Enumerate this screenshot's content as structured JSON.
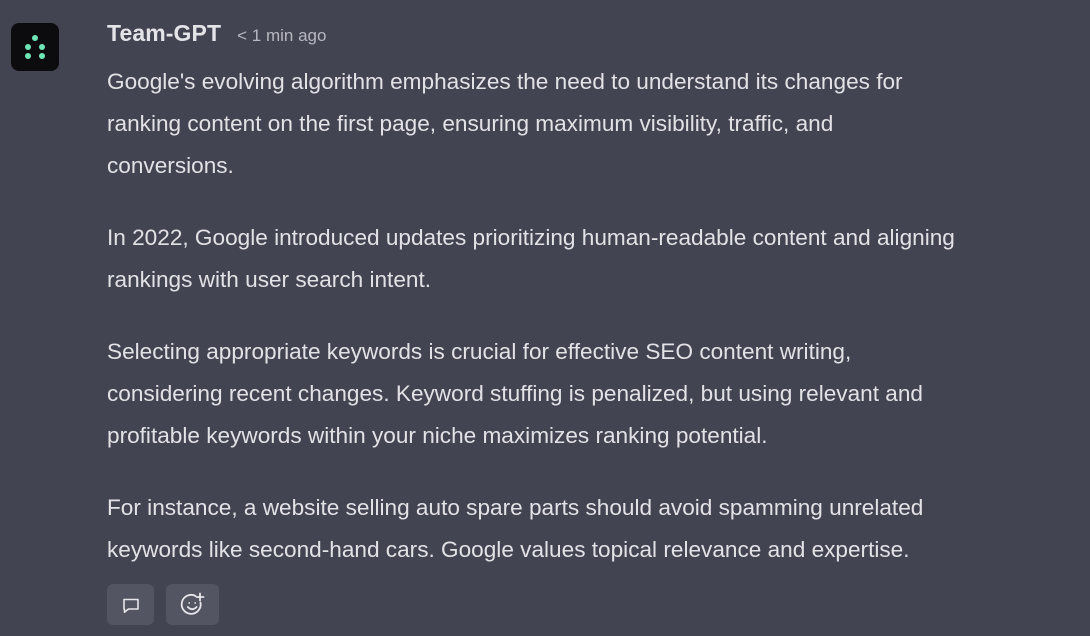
{
  "message": {
    "author": "Team-GPT",
    "timestamp": "< 1 min ago",
    "avatar_icon": "team-gpt-logo-icon",
    "accent_color": "#6ee7b7",
    "paragraphs": [
      {
        "lines": [
          "Google's evolving algorithm emphasizes the need to understand its changes for",
          "ranking content on the first page, ensuring maximum visibility, traffic, and",
          "conversions."
        ]
      },
      {
        "lines": [
          "In 2022, Google introduced updates prioritizing human-readable content and aligning",
          "rankings with user search intent."
        ]
      },
      {
        "lines": [
          "Selecting appropriate keywords is crucial for effective SEO content writing,",
          "considering recent changes. Keyword stuffing is penalized, but using relevant and",
          "profitable keywords within your niche maximizes ranking potential."
        ]
      },
      {
        "lines": [
          "For instance, a website selling auto spare parts should avoid spamming unrelated",
          "keywords like second-hand cars. Google values topical relevance and expertise."
        ]
      }
    ],
    "actions": [
      {
        "name": "comment-button",
        "icon": "comment-icon"
      },
      {
        "name": "add-reaction-button",
        "icon": "add-reaction-icon"
      }
    ]
  }
}
